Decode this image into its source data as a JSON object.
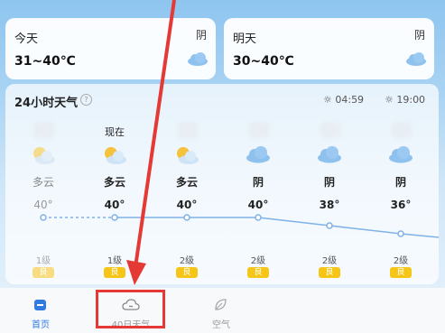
{
  "cards": {
    "today": {
      "title": "今天",
      "range": "31~40℃",
      "condition": "阴"
    },
    "tomorrow": {
      "title": "明天",
      "range": "30~40℃",
      "condition": "阴"
    }
  },
  "hourly": {
    "title": "24小时天气",
    "help_label": "?",
    "sunrise": "04:59",
    "sunset": "19:00",
    "columns": [
      {
        "time": "",
        "condition": "多云",
        "temp": "40°",
        "wind": "1级",
        "aqi": "良",
        "dim": true
      },
      {
        "time": "现在",
        "condition": "多云",
        "temp": "40°",
        "wind": "1级",
        "aqi": "良",
        "dim": false
      },
      {
        "time": "",
        "condition": "多云",
        "temp": "40°",
        "wind": "2级",
        "aqi": "良",
        "dim": false
      },
      {
        "time": "",
        "condition": "阴",
        "temp": "40°",
        "wind": "2级",
        "aqi": "良",
        "dim": false
      },
      {
        "time": "",
        "condition": "阴",
        "temp": "38°",
        "wind": "2级",
        "aqi": "良",
        "dim": false
      },
      {
        "time": "",
        "condition": "阴",
        "temp": "36°",
        "wind": "2级",
        "aqi": "良",
        "dim": false
      }
    ],
    "icons": [
      "partly-cloudy-icon",
      "partly-cloudy-icon",
      "partly-cloudy-icon",
      "cloud-icon",
      "cloud-icon",
      "cloud-icon"
    ]
  },
  "nav": {
    "home": "首页",
    "forecast40": "40日天气",
    "air": "空气"
  },
  "colors": {
    "accent": "#2f7be0",
    "aqi": "#f5c518",
    "arrow": "#e53935",
    "line": "#7fb2e6"
  }
}
